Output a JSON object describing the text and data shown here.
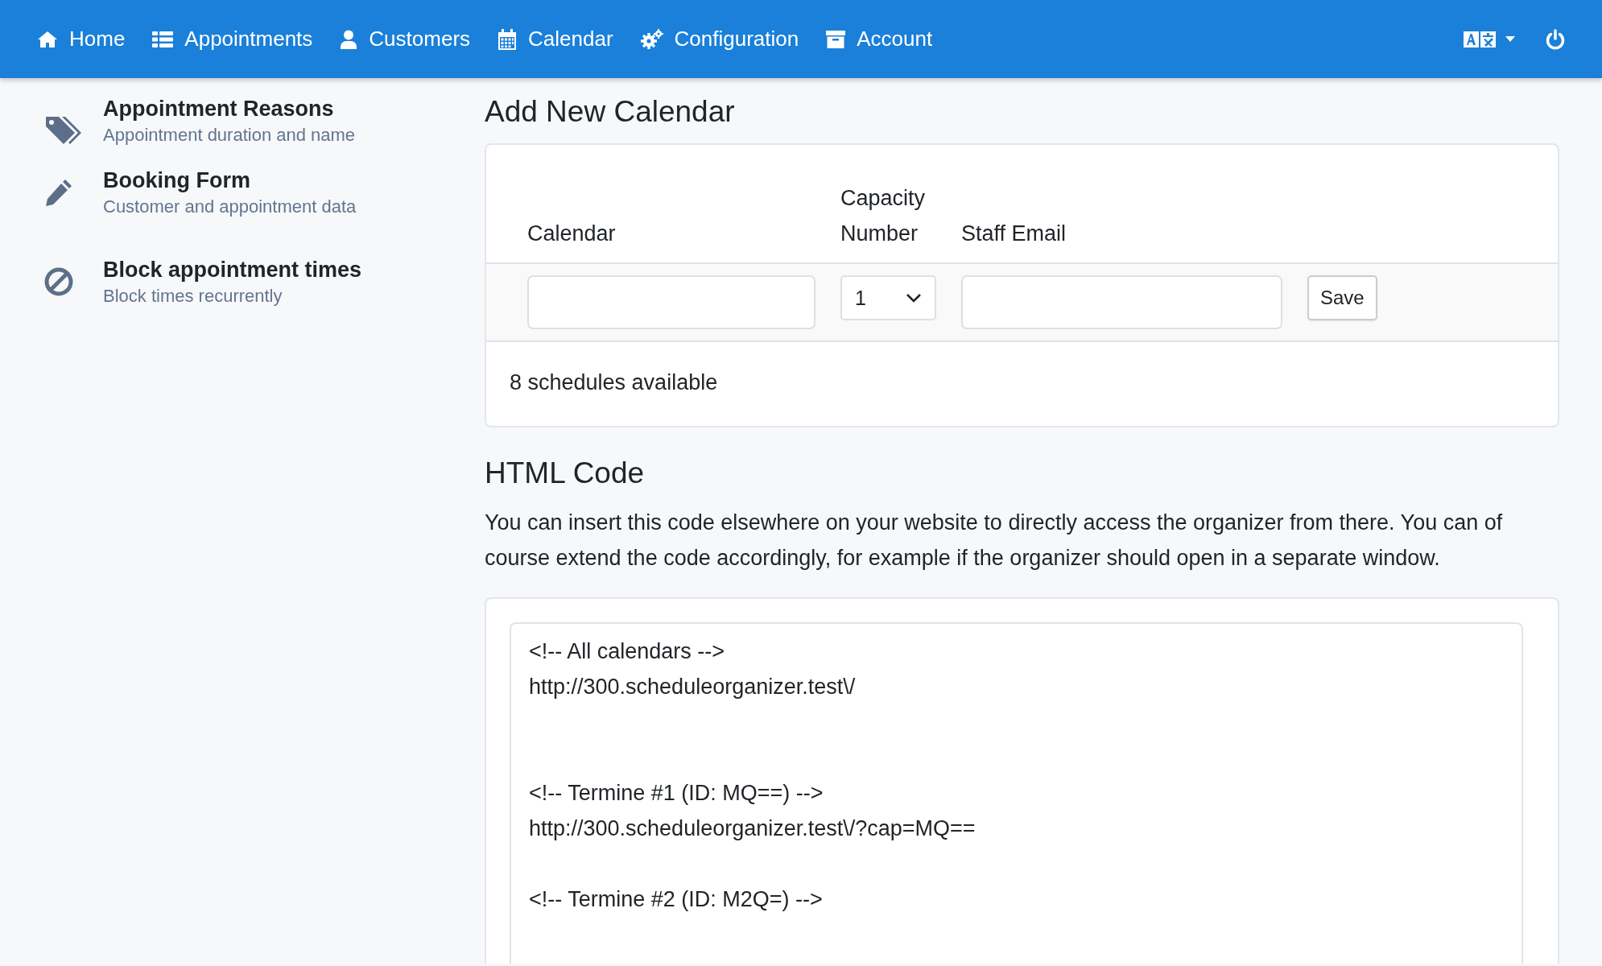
{
  "nav": {
    "items": [
      {
        "kind": "home",
        "label": "Home"
      },
      {
        "kind": "list",
        "label": "Appointments"
      },
      {
        "kind": "user",
        "label": "Customers"
      },
      {
        "kind": "calendar",
        "label": "Calendar"
      },
      {
        "kind": "gears",
        "label": "Configuration"
      },
      {
        "kind": "archive",
        "label": "Account"
      }
    ]
  },
  "sidebar": {
    "items": [
      {
        "kind": "tag",
        "title": "Appointment Reasons",
        "subtitle": "Appointment duration and name"
      },
      {
        "kind": "pencil",
        "title": "Booking Form",
        "subtitle": "Customer and appointment data"
      },
      {
        "kind": "ban",
        "title": "Block appointment times",
        "subtitle": "Block times recurrently"
      }
    ]
  },
  "add_calendar": {
    "title": "Add New Calendar",
    "columns": [
      "Calendar",
      "Capacity Number",
      "Staff Email"
    ],
    "capacity_value": "1",
    "save_button": "Save",
    "footer": "8 schedules available"
  },
  "html_code": {
    "title": "HTML Code",
    "description": "You can insert this code elsewhere on your website to directly access the organizer from there. You can of course extend the code accordingly, for example if the organizer should open in a separate window.",
    "code": "<!-- All calendars -->\nhttp://300.scheduleorganizer.test\\/\n\n\n<!-- Termine #1 (ID: MQ==) -->\nhttp://300.scheduleorganizer.test\\/?cap=MQ==\n\n<!-- Termine #2 (ID: M2Q=) -->"
  }
}
